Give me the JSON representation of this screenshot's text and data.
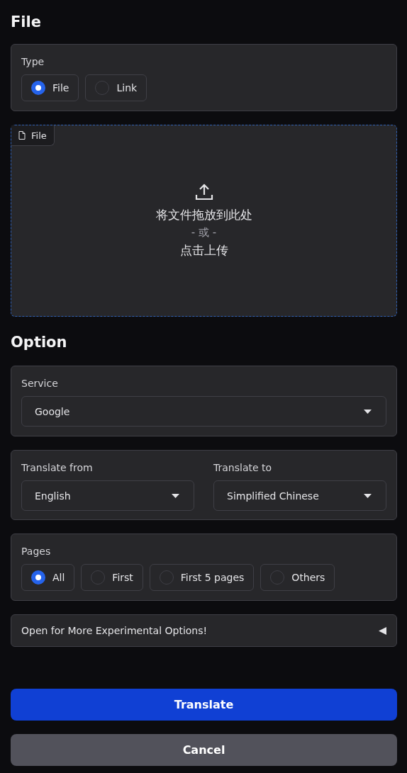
{
  "file_section": {
    "title": "File",
    "type_group": {
      "label": "Type",
      "options": [
        {
          "label": "File",
          "selected": true
        },
        {
          "label": "Link",
          "selected": false
        }
      ]
    },
    "dropzone": {
      "tab": "File",
      "line1": "将文件拖放到此处",
      "separator": "- 或 -",
      "line2": "点击上传"
    }
  },
  "option_section": {
    "title": "Option",
    "service": {
      "label": "Service",
      "value": "Google"
    },
    "languages": [
      {
        "label": "Translate from",
        "value": "English"
      },
      {
        "label": "Translate to",
        "value": "Simplified Chinese"
      }
    ],
    "pages": {
      "label": "Pages",
      "options": [
        {
          "label": "All",
          "selected": true
        },
        {
          "label": "First",
          "selected": false
        },
        {
          "label": "First 5 pages",
          "selected": false
        },
        {
          "label": "Others",
          "selected": false
        }
      ]
    },
    "experimental": {
      "label": "Open for More Experimental Options!",
      "expanded": false
    }
  },
  "buttons": [
    {
      "label": "Translate",
      "kind": "primary"
    },
    {
      "label": "Cancel",
      "kind": "secondary"
    }
  ]
}
